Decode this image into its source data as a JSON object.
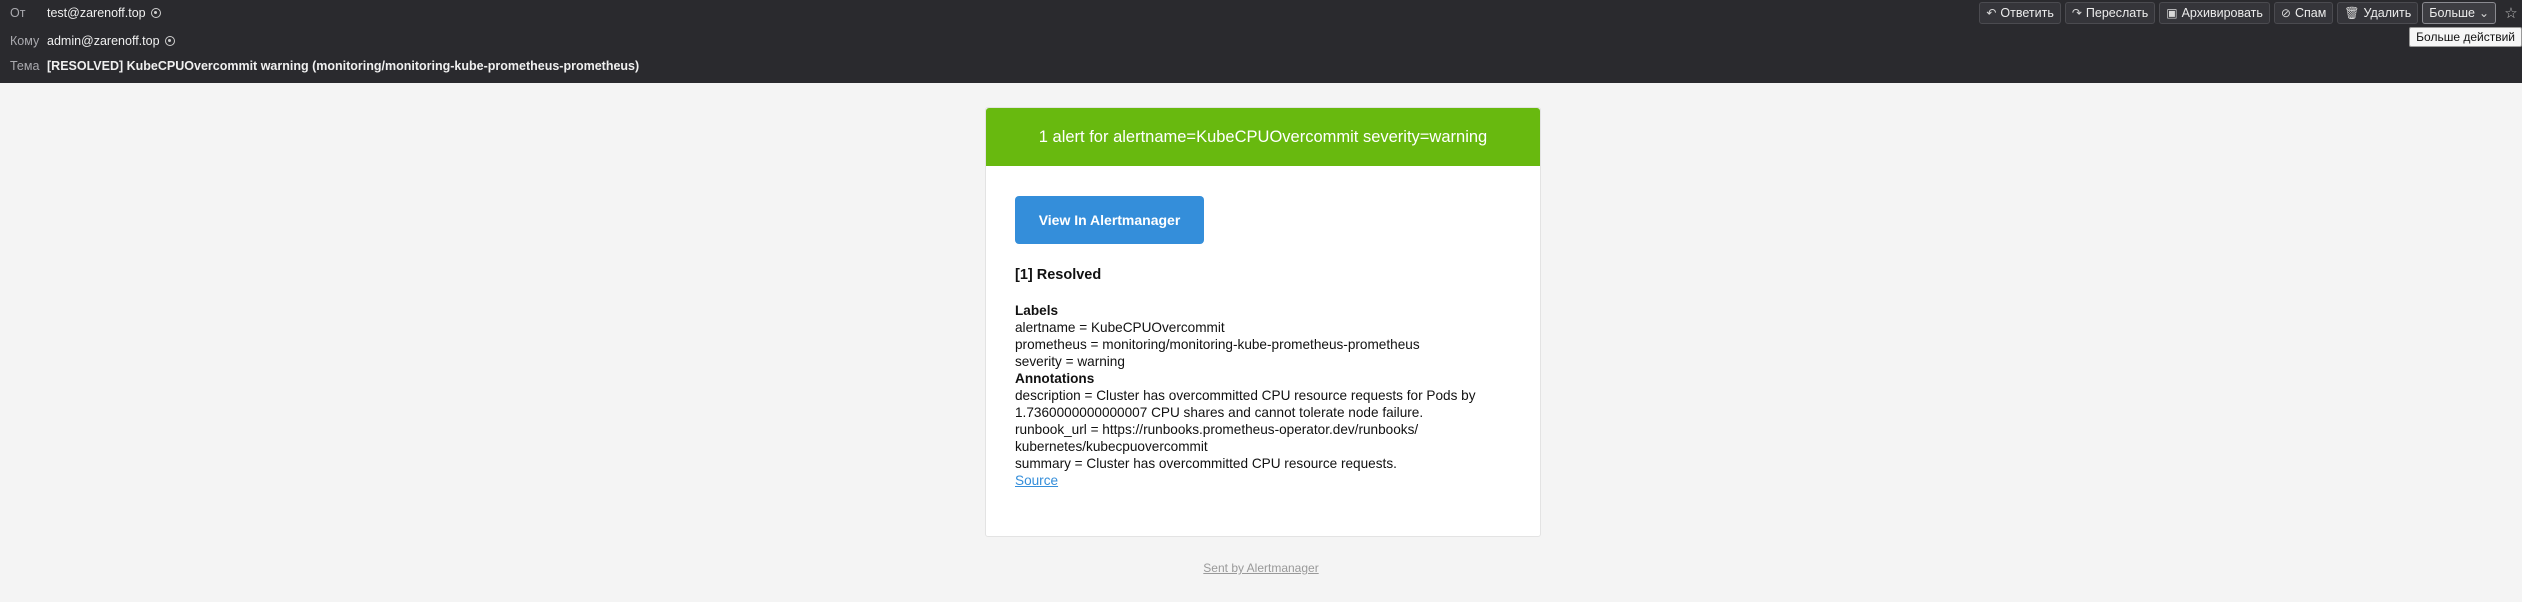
{
  "header": {
    "from_label": "От",
    "from_value": "test@zarenoff.top",
    "to_label": "Кому",
    "to_value": "admin@zarenoff.top",
    "subject_label": "Тема",
    "subject_value": "[RESOLVED] KubeCPUOvercommit warning (monitoring/monitoring-kube-prometheus-prometheus)",
    "actions": {
      "reply": "Ответить",
      "forward": "Переслать",
      "archive": "Архивировать",
      "spam": "Спам",
      "delete": "Удалить",
      "more": "Больше"
    },
    "tooltip": "Больше действий"
  },
  "email": {
    "banner": "1 alert for alertname=KubeCPUOvercommit severity=warning",
    "button": "View In Alertmanager",
    "resolved": "[1] Resolved",
    "labels_heading": "Labels",
    "labels": [
      "alertname = KubeCPUOvercommit",
      "prometheus = monitoring/monitoring-kube-prometheus-prometheus",
      "severity = warning"
    ],
    "annotations_heading": "Annotations",
    "annotations": [
      "description = Cluster has overcommitted CPU resource requests for Pods by",
      "1.7360000000000007 CPU shares and cannot tolerate node failure.",
      "runbook_url = https://runbooks.prometheus-operator.dev/runbooks/",
      "kubernetes/kubecpuovercommit",
      "summary = Cluster has overcommitted CPU resource requests."
    ],
    "source_link": "Source",
    "footer": "Sent by Alertmanager"
  },
  "colors": {
    "banner": "#68b90f",
    "button": "#348eda",
    "header_bg": "#2a2a2e"
  }
}
